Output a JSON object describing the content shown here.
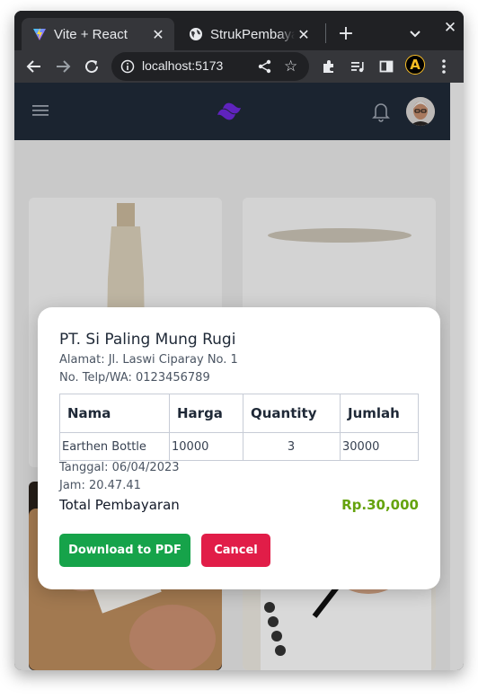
{
  "browser": {
    "tabs": [
      {
        "title": "Vite + React",
        "active": true,
        "favicon": "vite-icon"
      },
      {
        "title": "StrukPembayaran",
        "active": false,
        "favicon": "globe-icon"
      }
    ],
    "address": "localhost:5173"
  },
  "navbar": {
    "menu_icon": "hamburger-icon",
    "logo_icon": "tailwind-logo-icon",
    "bell_icon": "bell-icon"
  },
  "receipt": {
    "company": "PT. Si Paling Mung Rugi",
    "address": "Alamat: Jl. Laswi Ciparay No. 1",
    "phone": "No. Telp/WA: 0123456789",
    "headers": [
      "Nama",
      "Harga",
      "Quantity",
      "Jumlah"
    ],
    "rows": [
      {
        "nama": "Earthen Bottle",
        "harga": "10000",
        "quantity": "3",
        "jumlah": "30000"
      }
    ],
    "date": "Tanggal: 06/04/2023",
    "time": "Jam: 20.47.41",
    "total_label": "Total Pembayaran",
    "total_value": "Rp.30,000",
    "download_label": "Download to PDF",
    "cancel_label": "Cancel"
  },
  "colors": {
    "accent_green": "#16a34a",
    "cancel_red": "#e11d48",
    "total_green": "#65a30d",
    "navbar_bg": "#1f2937"
  }
}
